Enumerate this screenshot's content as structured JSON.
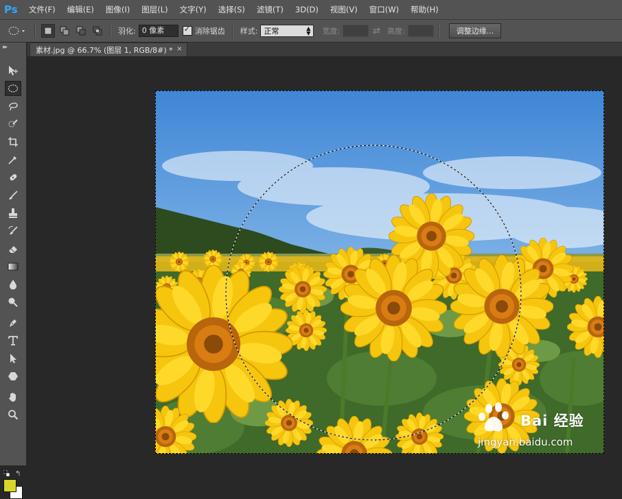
{
  "app": {
    "logo": "Ps"
  },
  "menu": [
    "文件(F)",
    "编辑(E)",
    "图像(I)",
    "图层(L)",
    "文字(Y)",
    "选择(S)",
    "滤镜(T)",
    "3D(D)",
    "视图(V)",
    "窗口(W)",
    "帮助(H)"
  ],
  "options": {
    "feather_label": "羽化:",
    "feather_value": "0 像素",
    "antialias_label": "消除锯齿",
    "antialias_checked": true,
    "style_label": "样式:",
    "style_value": "正常",
    "width_label": "宽度:",
    "height_label": "高度:",
    "refine_edge_label": "调整边缘..."
  },
  "document": {
    "tab_title": "素材.jpg @ 66.7% (图层 1, RGB/8#) *",
    "close_glyph": "×"
  },
  "tools": [
    "move-tool",
    "elliptical-marquee-tool",
    "lasso-tool",
    "quick-selection-tool",
    "crop-tool",
    "eyedropper-tool",
    "spot-healing-tool",
    "brush-tool",
    "clone-stamp-tool",
    "history-brush-tool",
    "eraser-tool",
    "gradient-tool",
    "blur-tool",
    "dodge-tool",
    "pen-tool",
    "type-tool",
    "path-selection-tool",
    "shape-tool",
    "hand-tool",
    "zoom-tool"
  ],
  "colors": {
    "foreground": "#d7d62b",
    "background": "#ffffff",
    "accent": "#31a8ff"
  },
  "watermark": {
    "brand_cn": "Bai 经验",
    "url": "jingyan.baidu.com"
  }
}
